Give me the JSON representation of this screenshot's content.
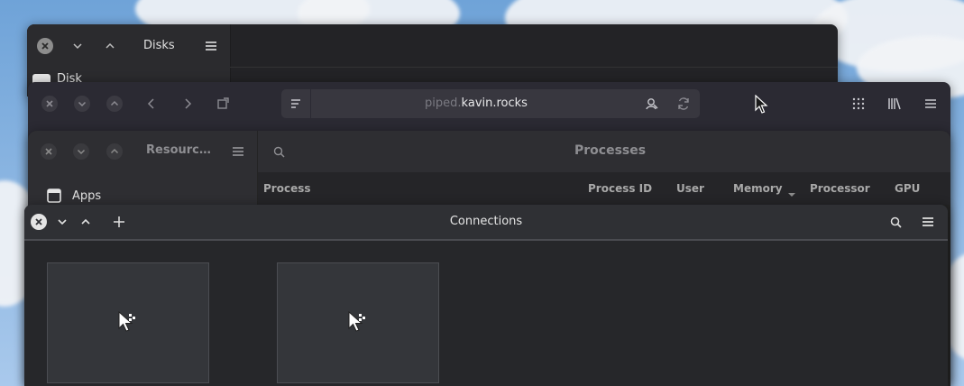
{
  "disks_window": {
    "title": "Disks",
    "sidebar_item": "Disk"
  },
  "browser_window": {
    "url_prefix": "piped.",
    "url_domain": "kavin.rocks"
  },
  "resources_window": {
    "sidebar_title": "Resourc…",
    "sidebar_item": "Apps",
    "main_title": "Processes",
    "columns": [
      "Process",
      "Process ID",
      "User",
      "Memory",
      "Processor",
      "GPU"
    ]
  },
  "connections_window": {
    "title": "Connections"
  },
  "icons": {
    "close": "close-icon",
    "minimize": "chevron-down-icon",
    "maximize": "chevron-up-icon",
    "menu": "hamburger-menu-icon",
    "search": "search-icon",
    "add": "plus-icon",
    "back": "back-arrow-icon",
    "forward": "forward-arrow-icon",
    "reload": "reload-icon",
    "extensions": "grid-dots-icon",
    "library": "library-icon",
    "cursor": "cursor-icon"
  }
}
